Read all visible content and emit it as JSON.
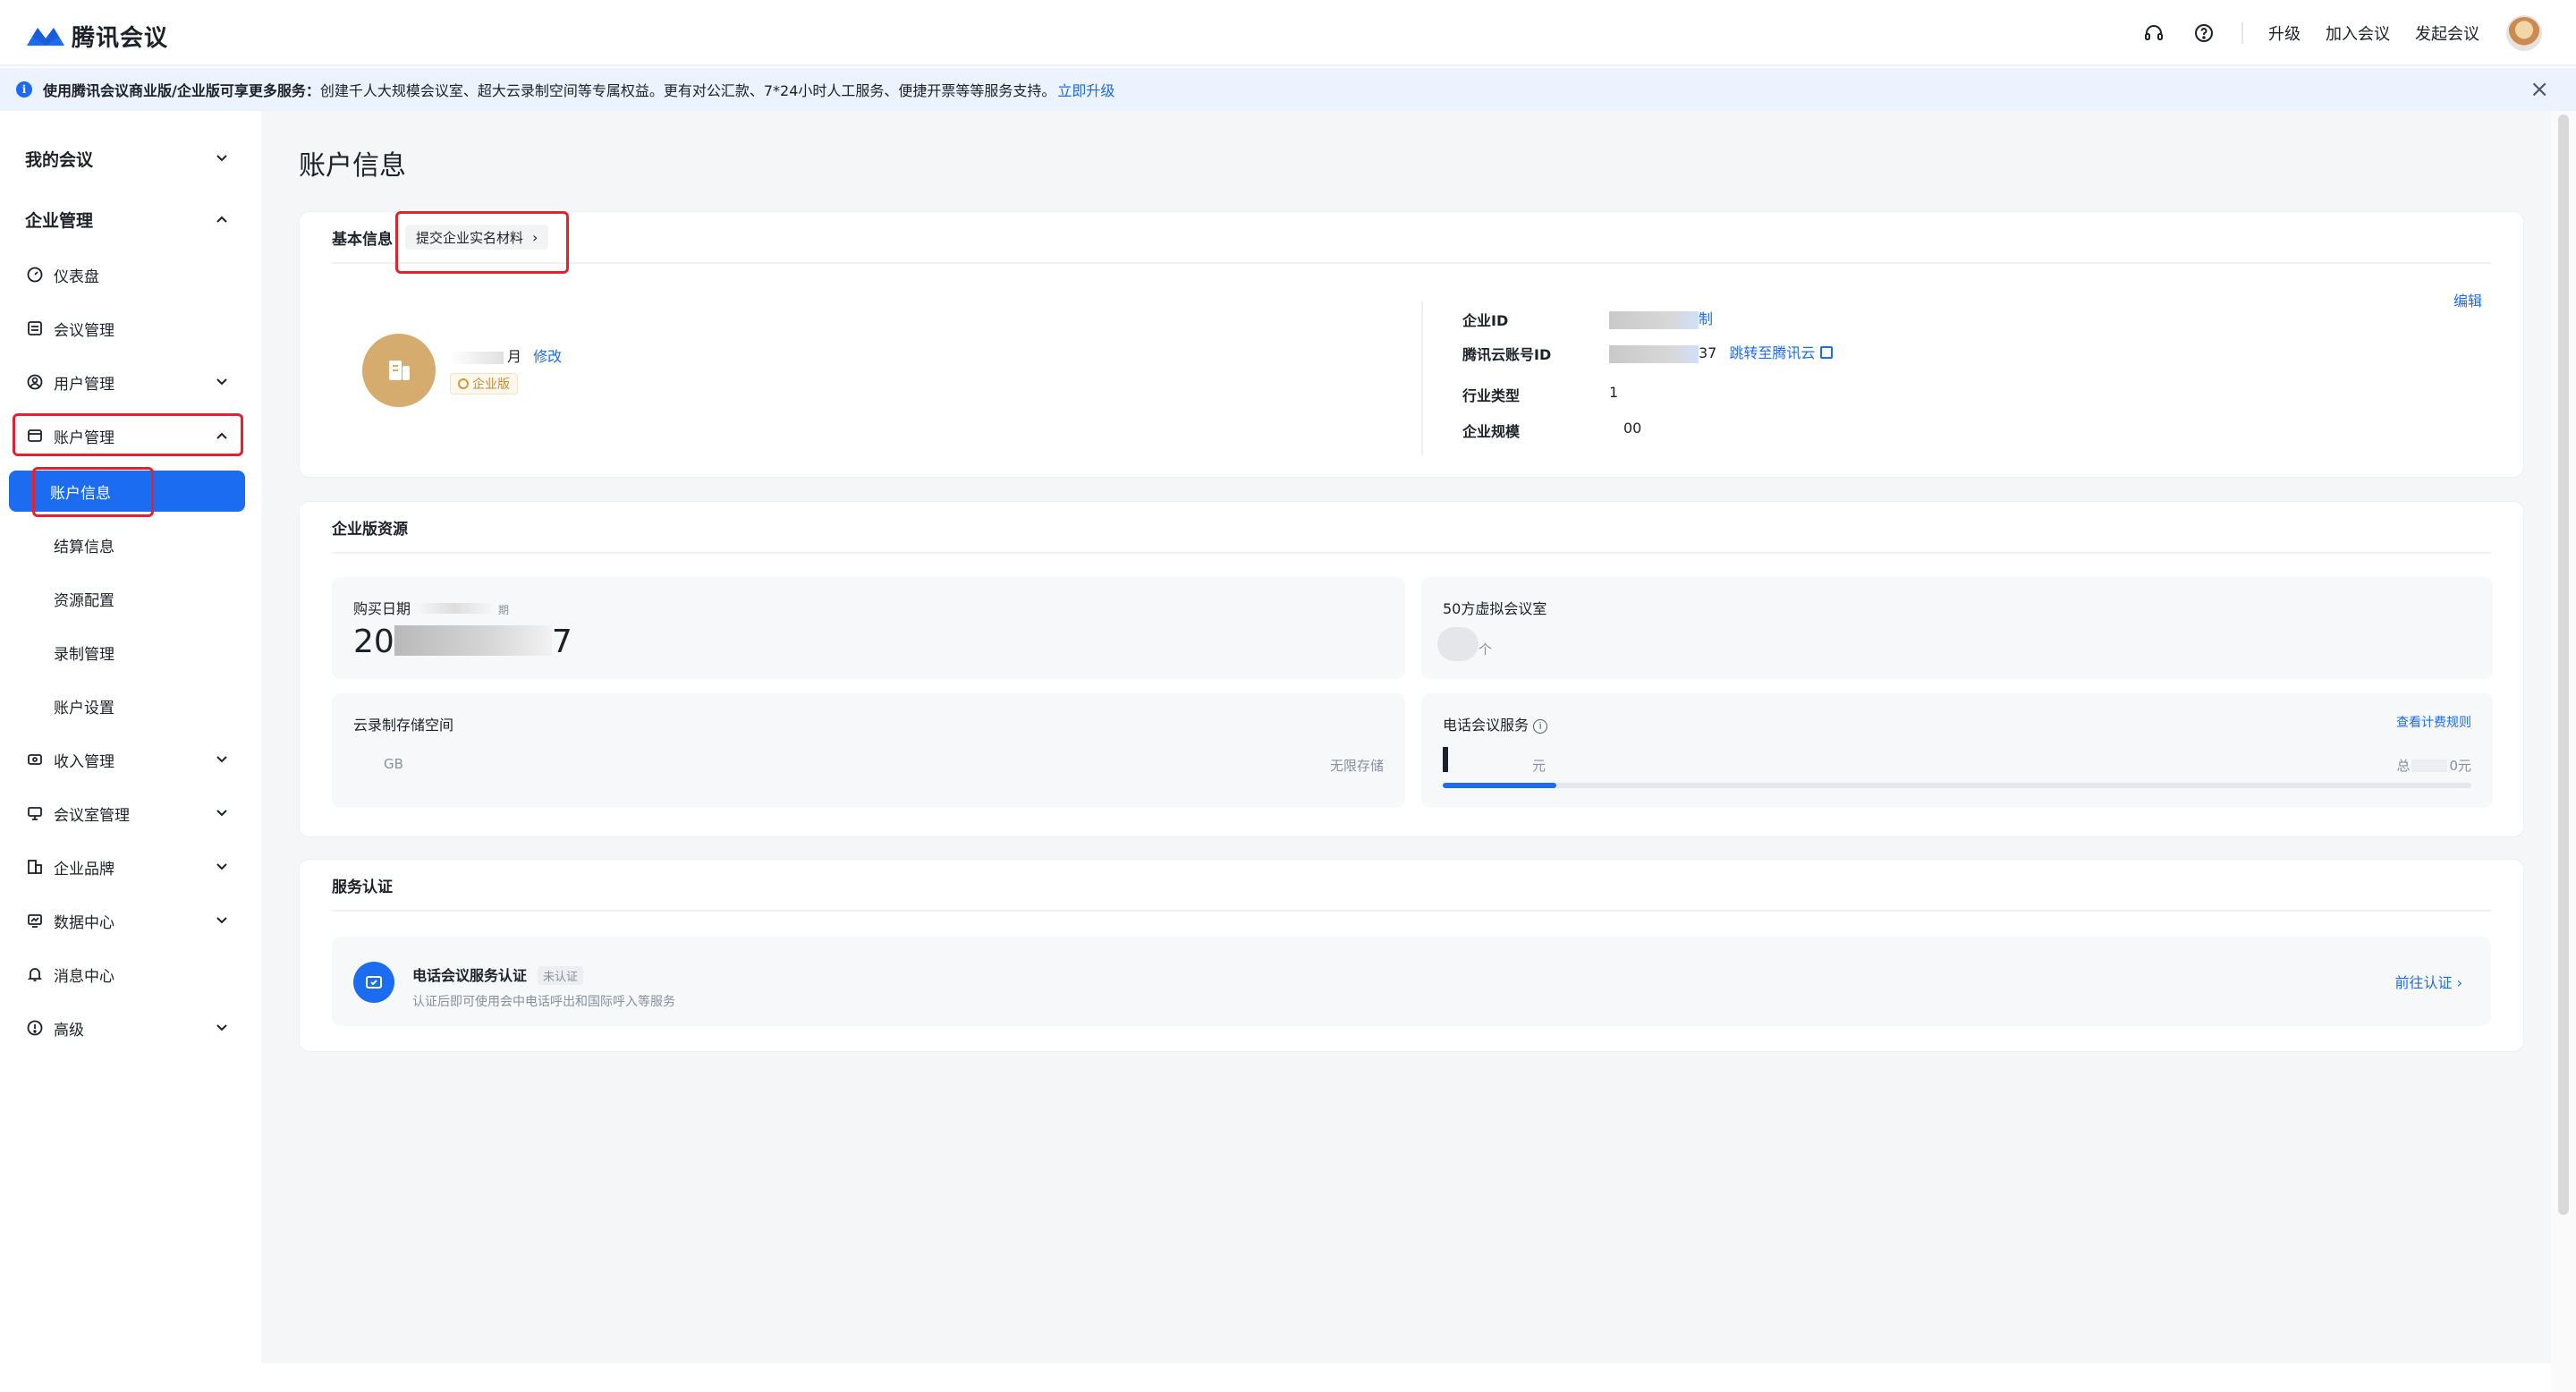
{
  "app": {
    "name": "腾讯会议",
    "brand_color": "#1c6cf2"
  },
  "topbar": {
    "upgrade": "升级",
    "join": "加入会议",
    "start": "发起会议",
    "icons": [
      "headset-icon",
      "help-icon"
    ]
  },
  "banner": {
    "bold": "使用腾讯会议商业版/企业版可享更多服务：",
    "text": "创建千人大规模会议室、超大云录制空间等专属权益。更有对公汇款、7*24小时人工服务、便捷开票等等服务支持。",
    "link": "立即升级"
  },
  "sidebar": {
    "my_meetings": "我的会议",
    "enterprise": "企业管理",
    "items": {
      "dashboard": "仪表盘",
      "meeting_mgmt": "会议管理",
      "user_mgmt": "用户管理",
      "account_mgmt": "账户管理",
      "account_info": "账户信息",
      "billing_info": "结算信息",
      "resource_config": "资源配置",
      "recording_mgmt": "录制管理",
      "account_settings": "账户设置",
      "income_mgmt": "收入管理",
      "room_mgmt": "会议室管理",
      "brand": "企业品牌",
      "data_center": "数据中心",
      "message_center": "消息中心",
      "advanced": "高级"
    }
  },
  "page": {
    "title": "账户信息",
    "basic": {
      "title": "基本信息",
      "submit_chip": "提交企业实名材料",
      "company_suffix": "月",
      "edit": "修改",
      "edition_badge": "企业版",
      "edit_right": "编辑",
      "enterprise_id_label": "企业ID",
      "enterprise_id_suffix": "制",
      "cloud_id_label": "腾讯云账号ID",
      "cloud_id_suffix": "37",
      "cloud_link": "跳转至腾讯云",
      "industry_label": "行业类型",
      "industry_value": "1",
      "scale_label": "企业规模",
      "scale_value": "00"
    },
    "resources": {
      "title": "企业版资源",
      "purchase_label": "购买日期",
      "purchase_suffix": "期",
      "purchase_value_prefix": "20",
      "purchase_value_suffix": "7",
      "virtual_room_label": "50方虚拟会议室",
      "virtual_room_unit": "个",
      "cloud_storage_label": "云录制存储空间",
      "cloud_storage_unit": "GB",
      "cloud_storage_right": "无限存储",
      "phone_label": "电话会议服务",
      "phone_rules": "查看计费规则",
      "phone_unit": "元",
      "phone_total_prefix": "总",
      "phone_total_suffix": "0元",
      "phone_progress": 0.11
    },
    "cert": {
      "title": "服务认证",
      "svc_title": "电话会议服务认证",
      "svc_tag": "未认证",
      "svc_desc": "认证后即可使用会中电话呼出和国际呼入等服务",
      "go": "前往认证"
    }
  }
}
